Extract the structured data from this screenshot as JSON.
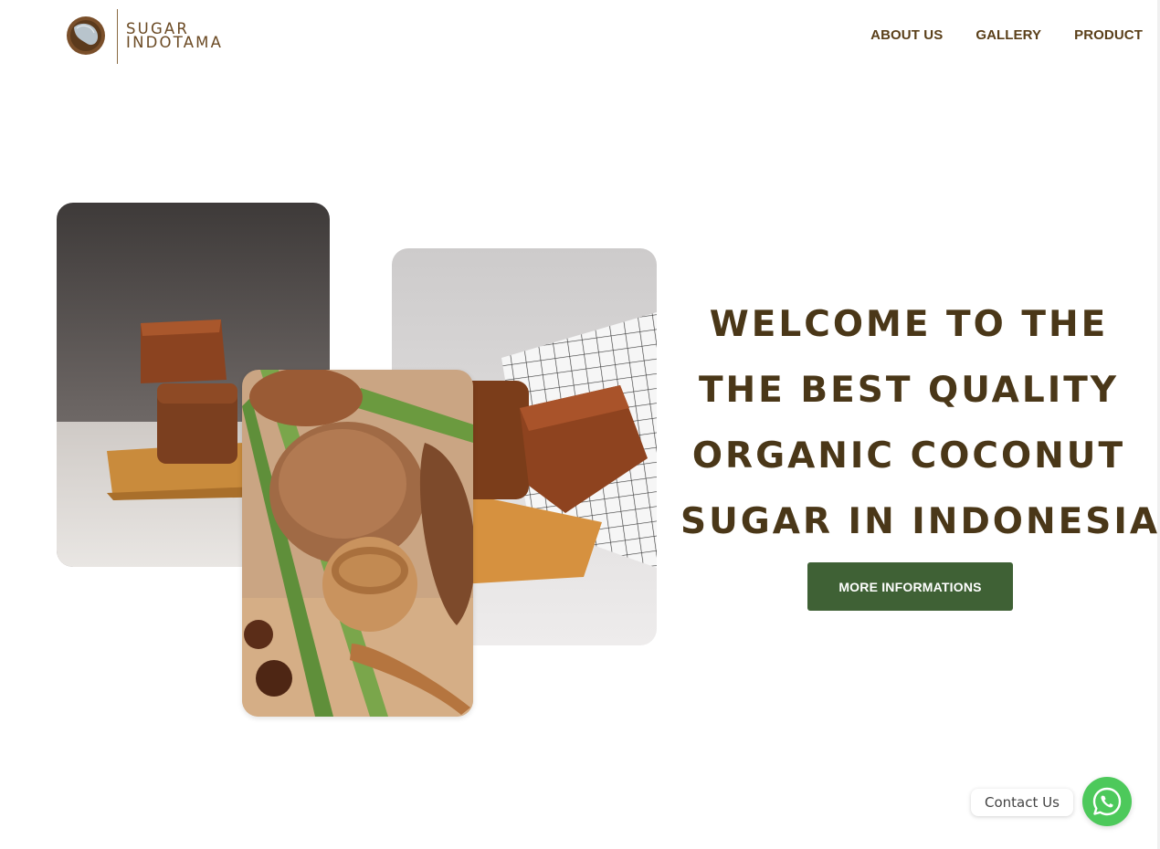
{
  "brand": {
    "line1": "SUGAR",
    "line2": "INDOTAMA",
    "logo_icon": "coconut-half-icon"
  },
  "nav": {
    "items": [
      "ABOUT US",
      "GALLERY",
      "PRODUCT"
    ]
  },
  "hero": {
    "lines": [
      "WELCOME TO THE",
      "THE BEST QUALITY",
      "ORGANIC COCONUT",
      "SUGAR IN INDONESIA"
    ],
    "cta_label": "MORE INFORMATIONS"
  },
  "contact": {
    "label": "Contact Us",
    "icon": "whatsapp-icon"
  },
  "colors": {
    "brand_brown": "#5a3f19",
    "heading_brown": "#4a3718",
    "cta_green": "#3f6135",
    "whatsapp_green": "#4dc95b"
  }
}
